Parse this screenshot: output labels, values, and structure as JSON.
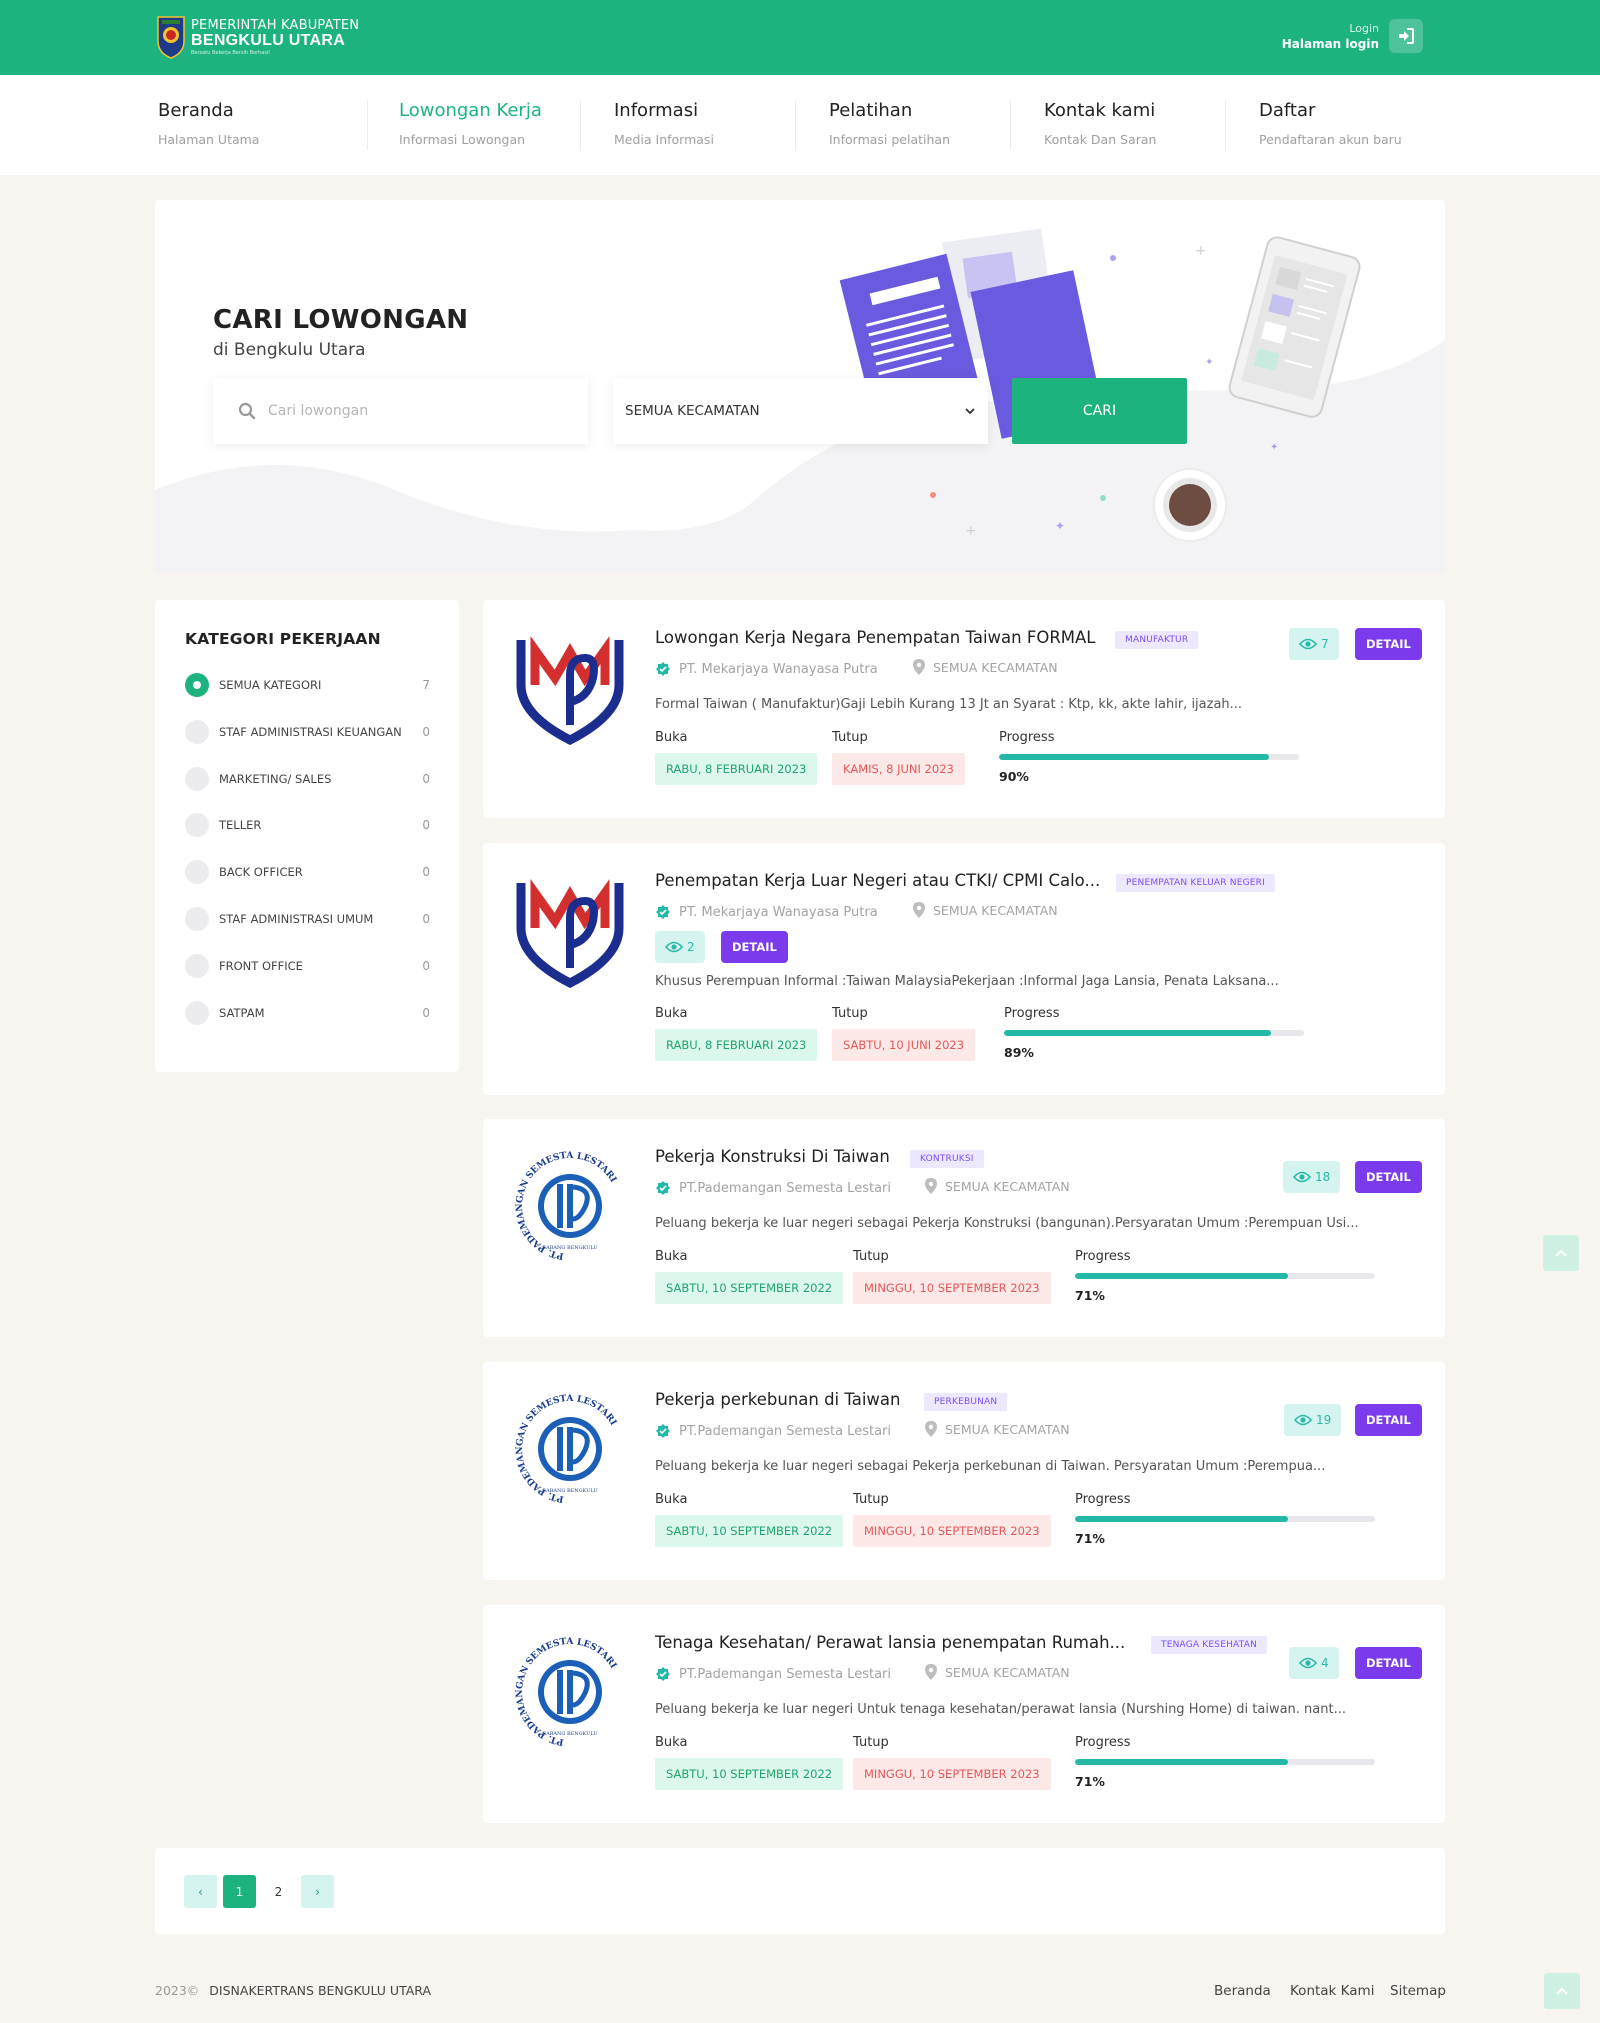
{
  "header": {
    "brand_line1": "PEMERINTAH KABUPATEN",
    "brand_line2": "BENGKULU UTARA",
    "brand_line3": "Bersatu Bekerja Bersih Berhasil",
    "login_small": "Login",
    "login_big": "Halaman login"
  },
  "nav": [
    {
      "label": "Beranda",
      "sub": "Halaman Utama"
    },
    {
      "label": "Lowongan Kerja",
      "sub": "Informasi Lowongan"
    },
    {
      "label": "Informasi",
      "sub": "Media Informasi"
    },
    {
      "label": "Pelatihan",
      "sub": "Informasi pelatihan"
    },
    {
      "label": "Kontak kami",
      "sub": "Kontak Dan Saran"
    },
    {
      "label": "Daftar",
      "sub": "Pendaftaran akun baru"
    }
  ],
  "hero": {
    "title": "CARI LOWONGAN",
    "subtitle": "di Bengkulu Utara",
    "search_placeholder": "Cari lowongan",
    "kecamatan_selected": "SEMUA KECAMATAN",
    "search_button": "CARI"
  },
  "sidebar": {
    "title": "KATEGORI PEKERJAAN",
    "categories": [
      {
        "name": "SEMUA KATEGORI",
        "count": "7"
      },
      {
        "name": "STAF ADMINISTRASI KEUANGAN",
        "count": "0"
      },
      {
        "name": "MARKETING/ SALES",
        "count": "0"
      },
      {
        "name": "TELLER",
        "count": "0"
      },
      {
        "name": "BACK OFFICER",
        "count": "0"
      },
      {
        "name": "STAF ADMINISTRASI UMUM",
        "count": "0"
      },
      {
        "name": "FRONT OFFICE",
        "count": "0"
      },
      {
        "name": "SATPAM",
        "count": "0"
      }
    ]
  },
  "labels": {
    "open": "Buka",
    "close": "Tutup",
    "progress": "Progress",
    "detail": "DETAIL"
  },
  "jobs": [
    {
      "title": "Lowongan Kerja Negara Penempatan Taiwan FORMAL",
      "badge": "MANUFAKTUR",
      "company": "PT. Mekarjaya Wanayasa Putra",
      "location": "SEMUA KECAMATAN",
      "views": "7",
      "desc": "Formal Taiwan ( Manufaktur)Gaji Lebih Kurang 13 Jt an Syarat : Ktp, kk, akte lahir, ijazah...",
      "open_date": "RABU, 8 FEBRUARI 2023",
      "close_date": "KAMIS, 8 JUNI 2023",
      "progress": 90,
      "progress_text": "90%",
      "logo": "mwp-logo"
    },
    {
      "title": "Penempatan Kerja Luar Negeri atau CTKI/ CPMI Calo...",
      "badge": "PENEMPATAN KELUAR NEGERI",
      "company": "PT. Mekarjaya Wanayasa Putra",
      "location": "SEMUA KECAMATAN",
      "views": "2",
      "desc": "Khusus Perempuan Informal :Taiwan MalaysiaPekerjaan :Informal Jaga Lansia, Penata Laksana...",
      "open_date": "RABU, 8 FEBRUARI 2023",
      "close_date": "SABTU, 10 JUNI 2023",
      "progress": 89,
      "progress_text": "89%",
      "logo": "mwp-logo"
    },
    {
      "title": "Pekerja Konstruksi Di Taiwan",
      "badge": "KONTRUKSI",
      "company": "PT.Pademangan Semesta Lestari",
      "location": "SEMUA KECAMATAN",
      "views": "18",
      "desc": "Peluang bekerja ke luar negeri sebagai Pekerja Konstruksi (bangunan).Persyaratan Umum :Perempuan Usi...",
      "open_date": "SABTU, 10 SEPTEMBER 2022",
      "close_date": "MINGGU, 10 SEPTEMBER 2023",
      "progress": 71,
      "progress_text": "71%",
      "logo": "psl-logo"
    },
    {
      "title": "Pekerja perkebunan di Taiwan",
      "badge": "PERKEBUNAN",
      "company": "PT.Pademangan Semesta Lestari",
      "location": "SEMUA KECAMATAN",
      "views": "19",
      "desc": "Peluang bekerja ke luar negeri sebagai Pekerja perkebunan di Taiwan. Persyaratan Umum :Perempua...",
      "open_date": "SABTU, 10 SEPTEMBER 2022",
      "close_date": "MINGGU, 10 SEPTEMBER 2023",
      "progress": 71,
      "progress_text": "71%",
      "logo": "psl-logo"
    },
    {
      "title": "Tenaga Kesehatan/ Perawat lansia penempatan Rumah...",
      "badge": "TENAGA KESEHATAN",
      "company": "PT.Pademangan Semesta Lestari",
      "location": "SEMUA KECAMATAN",
      "views": "4",
      "desc": "Peluang bekerja ke luar negeri Untuk tenaga kesehatan/perawat lansia (Nurshing Home) di taiwan. nant...",
      "open_date": "SABTU, 10 SEPTEMBER 2022",
      "close_date": "MINGGU, 10 SEPTEMBER 2023",
      "progress": 71,
      "progress_text": "71%",
      "logo": "psl-logo"
    }
  ],
  "logo_texts": {
    "psl_ring": "PT. PADEMANGAN SEMESTA LESTARI",
    "psl_bottom": "CABANG BENGKULU"
  },
  "pagination": {
    "pages": [
      "1",
      "2"
    ],
    "current": "1",
    "prev": "‹",
    "next": "›"
  },
  "footer": {
    "year": "2023©",
    "org": "DISNAKERTRANS BENGKULU UTARA",
    "links": [
      "Beranda",
      "Kontak Kami",
      "Sitemap"
    ]
  },
  "colors": {
    "brand_green": "#1db37f",
    "detail_purple": "#7c3aed",
    "progress_teal": "#23b9a6"
  }
}
